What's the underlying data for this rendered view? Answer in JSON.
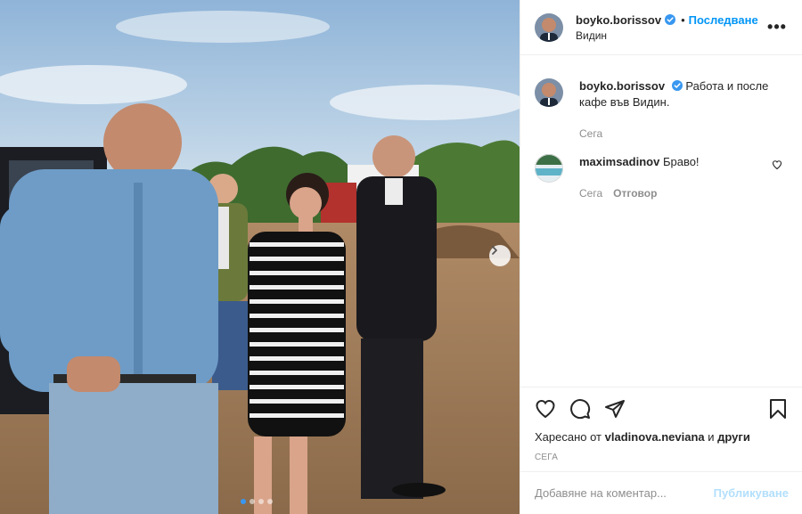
{
  "post": {
    "author": "boyko.borissov",
    "location": "Видин",
    "follow_label": "Последване",
    "bullet": "•",
    "more_label": "•••",
    "caption": "Работа и после кафе във Видин.",
    "caption_time": "Сега"
  },
  "comments": [
    {
      "username": "maximsadinov",
      "text": "Браво!",
      "time": "Сега",
      "reply_label": "Отговор"
    }
  ],
  "likes": {
    "prefix": "Харесано от",
    "user": "vladinova.neviana",
    "suffix": "и",
    "others": "други"
  },
  "post_time": "СЕГА",
  "add_comment": {
    "placeholder": "Добавяне на коментар...",
    "post_label": "Публикуване"
  },
  "carousel": {
    "dots": 4,
    "active_index": 0
  },
  "icons": {
    "verified": "verified-badge-icon",
    "like": "heart-icon",
    "comment": "comment-icon",
    "share": "share-icon",
    "save": "bookmark-icon",
    "next": "chevron-right-icon"
  },
  "colors": {
    "link": "#0095f6",
    "verified": "#3897f0",
    "muted": "#8e8e8e",
    "post_disabled": "#b2dffc"
  }
}
